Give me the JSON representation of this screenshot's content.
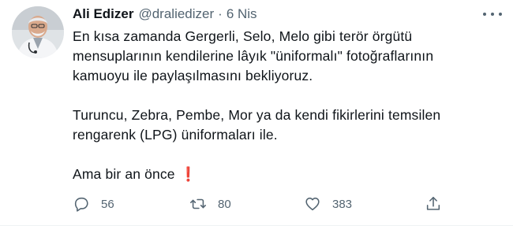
{
  "tweet": {
    "author_name": "Ali Edizer",
    "handle": "@draliedizer",
    "separator": "·",
    "date": "6 Nis",
    "text": {
      "line1": "En kısa zamanda Gergerli, Selo, Melo gibi terör örgütü",
      "line2": "mensuplarının kendilerine lâyık \"üniformalı\" fotoğraflarının",
      "line3": "kamuoyu ile paylaşılmasını bekliyoruz.",
      "line4": "Turuncu, Zebra, Pembe, Mor ya da kendi fikirlerini temsilen",
      "line5": "rengarenk (LPG) üniformaları ile.",
      "line6": "Ama bir an önce",
      "emoji": "❗"
    },
    "actions": {
      "reply_icon": "reply-icon",
      "reply_count": "56",
      "retweet_icon": "retweet-icon",
      "retweet_count": "80",
      "like_icon": "heart-icon",
      "like_count": "383",
      "share_icon": "share-icon"
    }
  },
  "colors": {
    "text": "#0f1419",
    "secondary": "#536471",
    "emoji": "#e0245e"
  }
}
